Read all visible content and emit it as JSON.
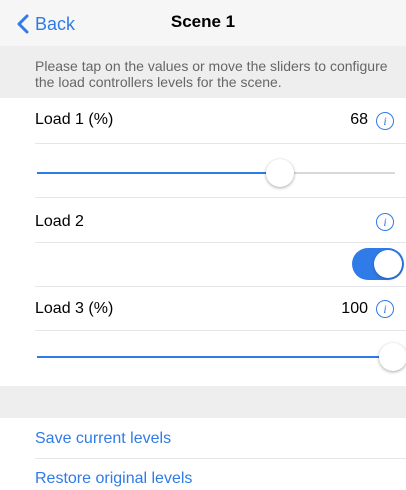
{
  "nav": {
    "back_label": "Back",
    "title": "Scene 1"
  },
  "instructions": "Please tap on the values or move the sliders to configure the load controllers levels for the scene.",
  "loads": [
    {
      "label": "Load 1 (%)",
      "value": "68",
      "slider_value": 0.68
    },
    {
      "label": "Load 2",
      "toggle_on": true
    },
    {
      "label": "Load 3 (%)",
      "value": "100",
      "slider_value": 1.0
    }
  ],
  "actions": {
    "save": "Save current levels",
    "restore": "Restore original levels"
  },
  "info_glyph": "i",
  "colors": {
    "accent": "#2f7be8",
    "section_bg": "#eeeeef"
  }
}
